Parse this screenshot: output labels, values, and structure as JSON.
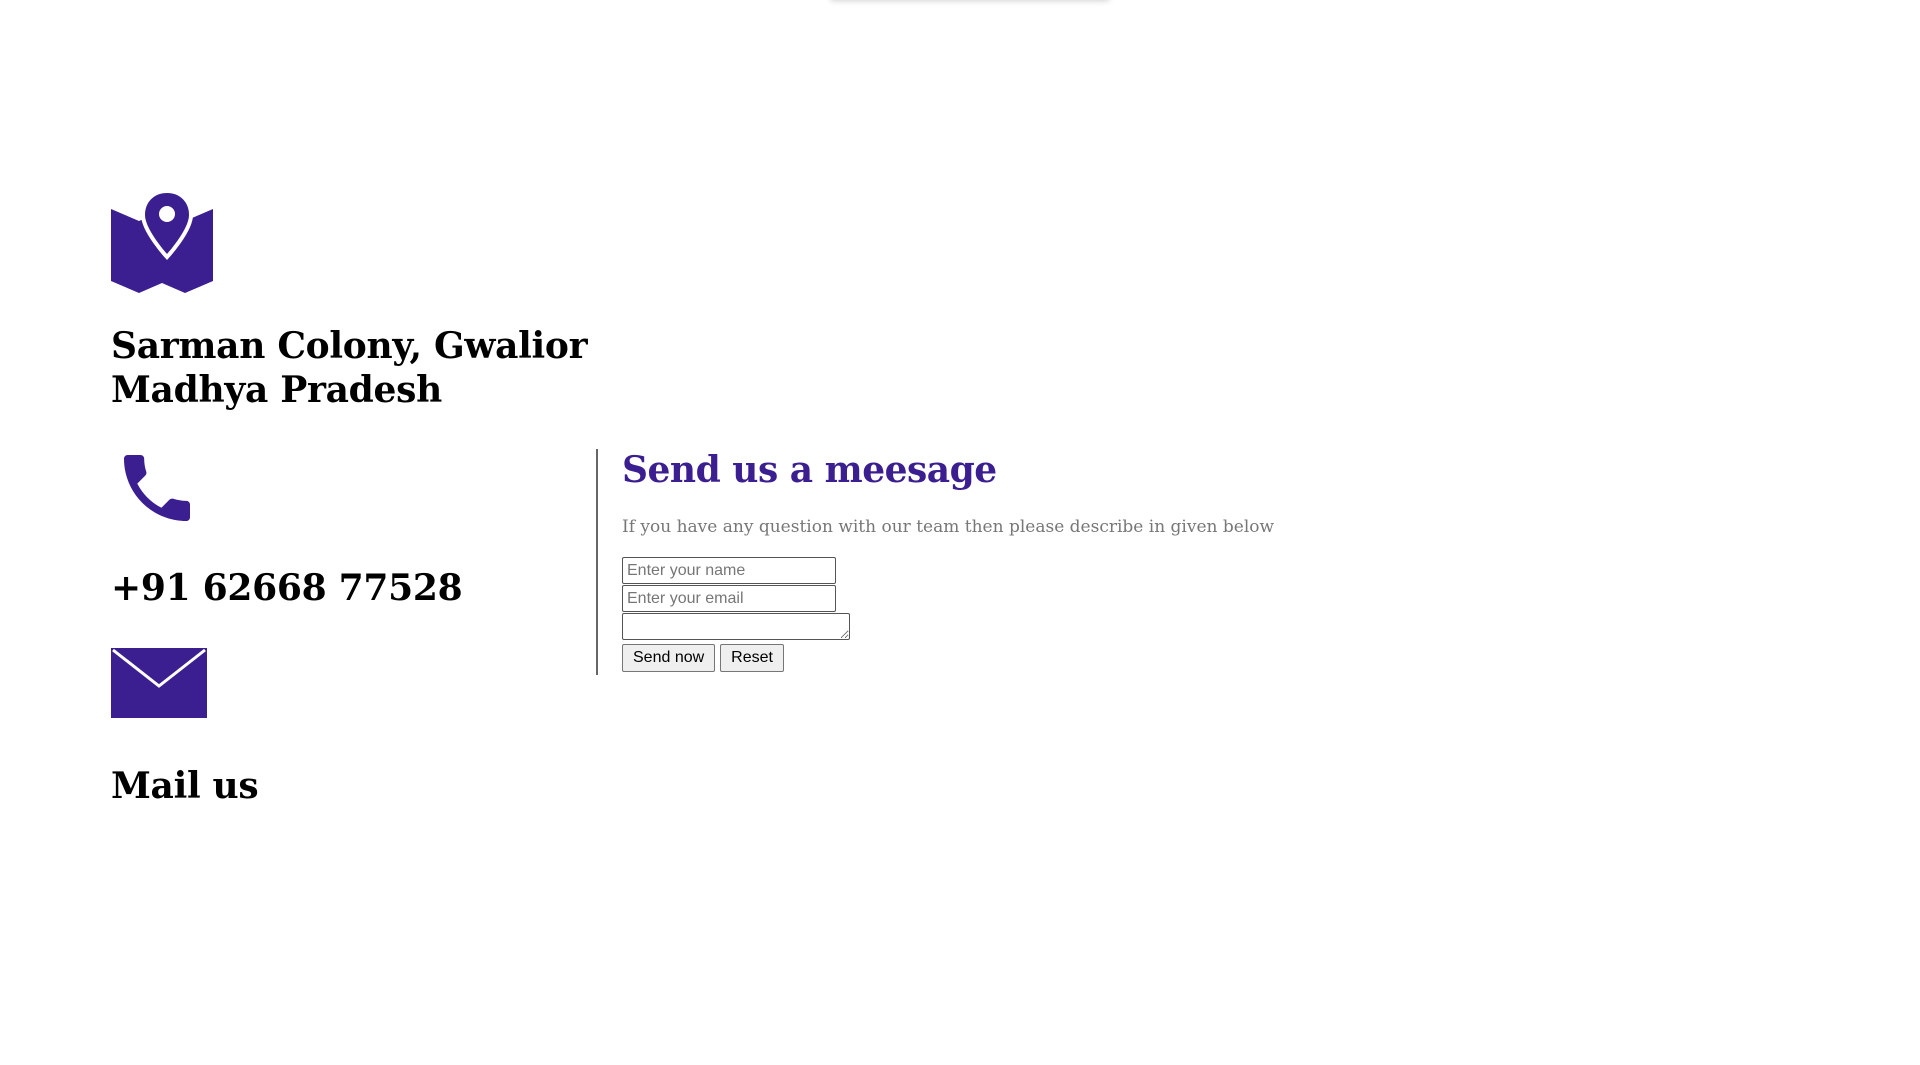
{
  "colors": {
    "accent": "#3b1e8f",
    "text": "#000000",
    "muted": "#777777",
    "divider": "#666666"
  },
  "contact": {
    "address": {
      "icon": "map-pin-icon",
      "text": "Sarman Colony, Gwalior\nMadhya Pradesh"
    },
    "phone": {
      "icon": "phone-icon",
      "text": "+91 62668 77528"
    },
    "mail": {
      "icon": "envelope-icon",
      "text": "Mail us"
    }
  },
  "form": {
    "title": "Send us a meesage",
    "description": "If you have any question with our team then please describe in given below",
    "name_placeholder": "Enter your name",
    "email_placeholder": "Enter your email",
    "message_value": "",
    "send_label": "Send now",
    "reset_label": "Reset"
  }
}
